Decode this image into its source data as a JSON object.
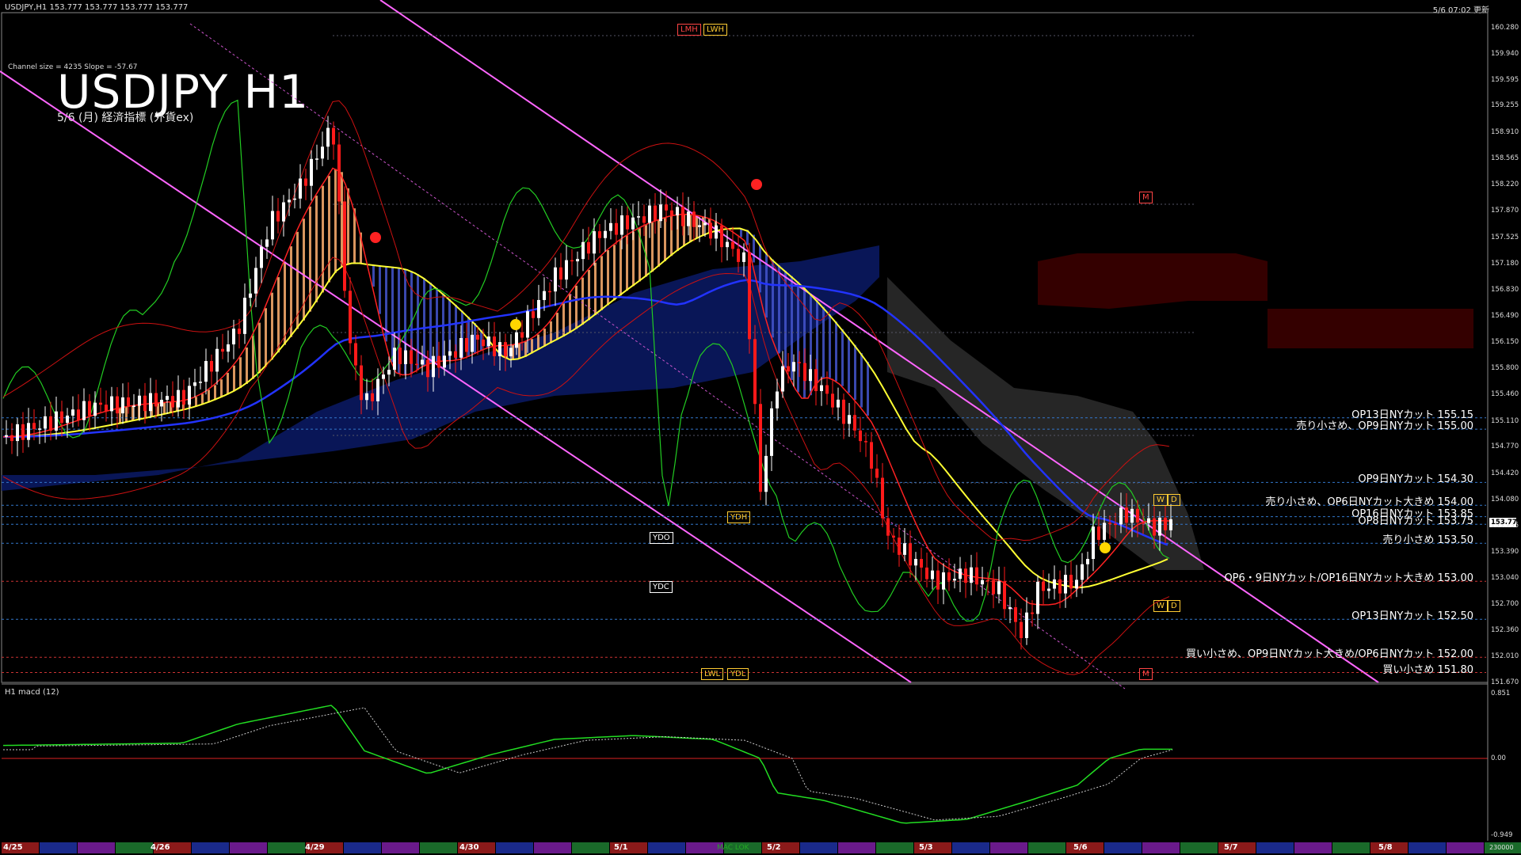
{
  "header": {
    "symbol_info": "USDJPY,H1  153.777 153.777 153.777 153.777",
    "updated": "5/6 07:02 更新",
    "channel_info": "Channel size = 4235  Slope = -57.67",
    "title": "USDJPY H1",
    "subtitle": "5/6 (月) 経済指標 (外貨ex)",
    "macd_label": "H1  macd (12)"
  },
  "chart_data": {
    "type": "candlestick",
    "title": "USDJPY H1",
    "price_axis_ticks": [
      "160.280",
      "159.940",
      "159.595",
      "159.255",
      "158.910",
      "158.565",
      "158.220",
      "157.870",
      "157.525",
      "157.180",
      "156.830",
      "156.490",
      "156.150",
      "155.800",
      "155.460",
      "155.110",
      "154.770",
      "154.420",
      "154.080",
      "153.735",
      "153.390",
      "153.040",
      "152.700",
      "152.360",
      "152.010",
      "151.670"
    ],
    "current_price": "153.777",
    "macd_ticks": [
      "0.851",
      "0.00",
      "-0.949"
    ],
    "date_labels": [
      "4/25",
      "4/26",
      "4/29",
      "4/30",
      "5/1",
      "5/2",
      "5/3",
      "5/6",
      "5/7",
      "5/8"
    ],
    "bottom_right": "230000",
    "levels": [
      {
        "text": "OP13日NYカット 155.15",
        "price": 155.15
      },
      {
        "text": "売り小さめ、OP9日NYカット 155.00",
        "price": 155.0
      },
      {
        "text": "OP9日NYカット 154.30",
        "price": 154.3
      },
      {
        "text": "売り小さめ、OP6日NYカット大きめ 154.00",
        "price": 154.0
      },
      {
        "text": "OP16日NYカット 153.85",
        "price": 153.85
      },
      {
        "text": "OP8日NYカット 153.75",
        "price": 153.75
      },
      {
        "text": "売り小さめ 153.50",
        "price": 153.5
      },
      {
        "text": "OP6・9日NYカット/OP16日NYカット大きめ 153.00",
        "price": 153.0
      },
      {
        "text": "OP13日NYカット 152.50",
        "price": 152.5
      },
      {
        "text": "買い小さめ、OP9日NYカット大きめ/OP6日NYカット 152.00",
        "price": 152.0
      },
      {
        "text": "買い小さめ 151.80",
        "price": 151.8
      }
    ],
    "tags": {
      "lmh": "LMH",
      "lwh": "LWH",
      "lwl": "LWL",
      "ydl": "YDL",
      "ydh": "YDH",
      "ydo": "YDO",
      "ydc": "YDC",
      "m": "M",
      "w": "W",
      "d": "D",
      "mac": "MAC LOK"
    },
    "colors": {
      "bull": "#ffffff",
      "bear": "#ff1a1a",
      "ma_yellow": "#ffff33",
      "ma_blue": "#2233ff",
      "cloud_orange": "#ffb070",
      "channel": "#ff66ff",
      "macd": "#22dd22",
      "macd_neg": "#ff99cc",
      "signal": "#cccccc"
    }
  }
}
